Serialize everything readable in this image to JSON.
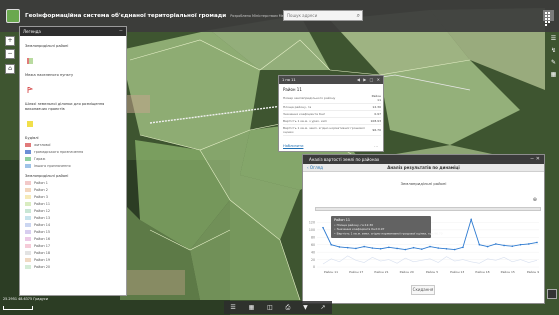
{
  "header": {
    "title": "Геоінформаційна система об'єднаної територіальної громади",
    "subtitle": "Розроблено Міністерством Меліорації Технологій",
    "search_placeholder": "Пошук адреси"
  },
  "legend": {
    "title": "Легенда",
    "sections": [
      {
        "label": "Земляпридільні районі"
      },
      {
        "label": "Межа населеного пункту"
      },
      {
        "label": "Шляхі земельної ділянки для розміщення виконавчих проектів"
      }
    ],
    "buildings": {
      "label": "Будівлі",
      "items": [
        {
          "label": "житлової",
          "color": "#e17a7a"
        },
        {
          "label": "громадського призначення",
          "color": "#6c8fd6"
        },
        {
          "label": "Гараж",
          "color": "#8fd0a0"
        },
        {
          "label": "іншого призначення",
          "color": "#9fc3e8"
        }
      ]
    },
    "districts": {
      "label": "Земляпридільні районі",
      "items": [
        "Район 1",
        "Район 2",
        "Район 3",
        "Район 11",
        "Район 12",
        "Район 13",
        "Район 14",
        "Район 15",
        "Район 16",
        "Район 17",
        "Район 18",
        "Район 19",
        "Район 20"
      ],
      "colors": [
        "#f2c9c9",
        "#f3d6bd",
        "#f6eab7",
        "#d9ecc0",
        "#c8e6d4",
        "#c6e3ec",
        "#cbd6f1",
        "#d7cdef",
        "#ecc9e6",
        "#f5cbd8",
        "#e3e3e3",
        "#f0d9c2",
        "#d4ecd6"
      ]
    }
  },
  "popup": {
    "header": "1 по 11",
    "title": "Район 11",
    "rows": [
      {
        "k": "Номер земляпридільного району",
        "v": "Район 11"
      },
      {
        "k": "Площа району, га",
        "v": "12.30"
      },
      {
        "k": "Значення коефіцієнта Кн2",
        "v": "0.97"
      },
      {
        "k": "Вартість 1 кв.м. з урах. кмп",
        "v": "108.93"
      },
      {
        "k": "Вартість 1 кв.м. земл. згідно нормативної грошової оцінки",
        "v": "96.70"
      }
    ],
    "footer_link": "Наблизити",
    "more": "..."
  },
  "widget": {
    "header": "Аналіз вартості землі по районах",
    "back": "Огляд",
    "tab_title": "Аналіз результатів по динаміці",
    "chart_title": "Земляпридільні районі",
    "reset": "Скидання",
    "tooltip": {
      "title": "Район 11",
      "lines": [
        "Площа району, га:12.30",
        "Значення коефіцієнта Кн2:0.97",
        "Вартість 1 кв.м. земл. згідно нормативної грошової оцінки, грн:96.70"
      ]
    }
  },
  "chart_data": {
    "type": "line",
    "categories": [
      "Район 11",
      "Район 17",
      "Район 21",
      "Район 20",
      "Район 5",
      "Район 13",
      "Район 18",
      "Район 15",
      "Район 9"
    ],
    "ylim": [
      0,
      140
    ],
    "yticks": [
      0,
      20,
      40,
      60,
      80,
      100,
      120
    ],
    "series": [
      {
        "color": "#d8e0ef",
        "values": [
          8,
          22,
          14,
          30,
          18,
          12,
          26,
          16,
          20,
          10,
          24,
          14,
          18,
          22,
          12,
          28,
          16,
          20,
          14,
          10,
          22,
          18,
          26,
          14,
          20,
          12,
          18
        ]
      },
      {
        "color": "#2e7bd1",
        "values": [
          106,
          60,
          54,
          52,
          50,
          55,
          51,
          49,
          53,
          50,
          47,
          52,
          48,
          55,
          51,
          49,
          47,
          53,
          128,
          60,
          55,
          62,
          58,
          56,
          60,
          62,
          66
        ]
      }
    ]
  },
  "map": {
    "scale_label": "0   500 м",
    "coords": "25.2951 48.6375 Градуси"
  }
}
